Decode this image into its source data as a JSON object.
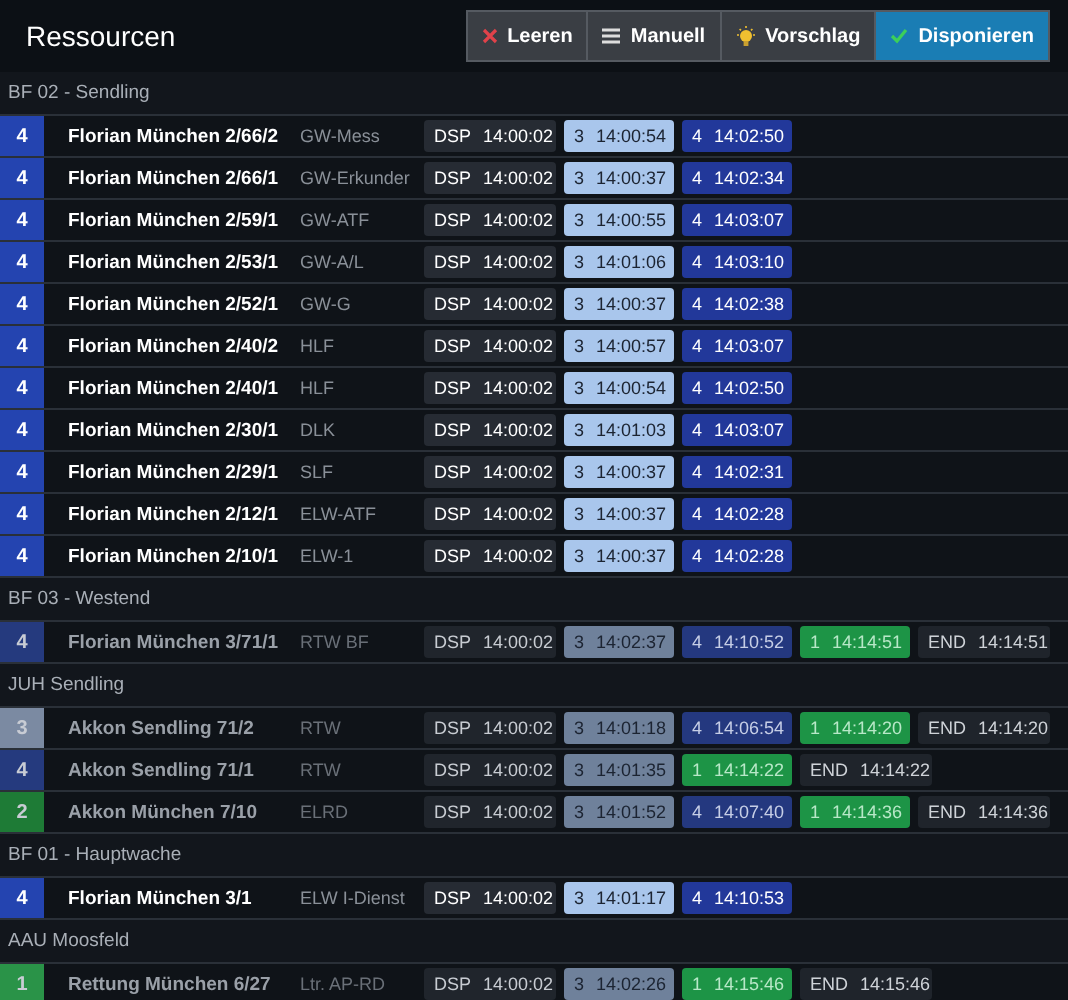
{
  "title": "Ressourcen",
  "buttons": [
    {
      "label": "Leeren",
      "kind": "clear"
    },
    {
      "label": "Manuell",
      "kind": "manual"
    },
    {
      "label": "Vorschlag",
      "kind": "suggest"
    },
    {
      "label": "Disponieren",
      "kind": "dispatch"
    }
  ],
  "groups": [
    {
      "name": "BF 02 - Sendling",
      "rows": [
        {
          "status": "4",
          "color": "#2444b0",
          "active": true,
          "name": "Florian München 2/66/2",
          "type": "GW-Mess",
          "chips": [
            {
              "kind": "dsp",
              "code": "DSP",
              "time": "14:00:02"
            },
            {
              "kind": "s3",
              "code": "3",
              "time": "14:00:54"
            },
            {
              "kind": "s4",
              "code": "4",
              "time": "14:02:50"
            }
          ]
        },
        {
          "status": "4",
          "color": "#2444b0",
          "active": true,
          "name": "Florian München 2/66/1",
          "type": "GW-Erkunder",
          "chips": [
            {
              "kind": "dsp",
              "code": "DSP",
              "time": "14:00:02"
            },
            {
              "kind": "s3",
              "code": "3",
              "time": "14:00:37"
            },
            {
              "kind": "s4",
              "code": "4",
              "time": "14:02:34"
            }
          ]
        },
        {
          "status": "4",
          "color": "#2444b0",
          "active": true,
          "name": "Florian München 2/59/1",
          "type": "GW-ATF",
          "chips": [
            {
              "kind": "dsp",
              "code": "DSP",
              "time": "14:00:02"
            },
            {
              "kind": "s3",
              "code": "3",
              "time": "14:00:55"
            },
            {
              "kind": "s4",
              "code": "4",
              "time": "14:03:07"
            }
          ]
        },
        {
          "status": "4",
          "color": "#2444b0",
          "active": true,
          "name": "Florian München 2/53/1",
          "type": "GW-A/L",
          "chips": [
            {
              "kind": "dsp",
              "code": "DSP",
              "time": "14:00:02"
            },
            {
              "kind": "s3",
              "code": "3",
              "time": "14:01:06"
            },
            {
              "kind": "s4",
              "code": "4",
              "time": "14:03:10"
            }
          ]
        },
        {
          "status": "4",
          "color": "#2444b0",
          "active": true,
          "name": "Florian München 2/52/1",
          "type": "GW-G",
          "chips": [
            {
              "kind": "dsp",
              "code": "DSP",
              "time": "14:00:02"
            },
            {
              "kind": "s3",
              "code": "3",
              "time": "14:00:37"
            },
            {
              "kind": "s4",
              "code": "4",
              "time": "14:02:38"
            }
          ]
        },
        {
          "status": "4",
          "color": "#2444b0",
          "active": true,
          "name": "Florian München 2/40/2",
          "type": "HLF",
          "chips": [
            {
              "kind": "dsp",
              "code": "DSP",
              "time": "14:00:02"
            },
            {
              "kind": "s3",
              "code": "3",
              "time": "14:00:57"
            },
            {
              "kind": "s4",
              "code": "4",
              "time": "14:03:07"
            }
          ]
        },
        {
          "status": "4",
          "color": "#2444b0",
          "active": true,
          "name": "Florian München 2/40/1",
          "type": "HLF",
          "chips": [
            {
              "kind": "dsp",
              "code": "DSP",
              "time": "14:00:02"
            },
            {
              "kind": "s3",
              "code": "3",
              "time": "14:00:54"
            },
            {
              "kind": "s4",
              "code": "4",
              "time": "14:02:50"
            }
          ]
        },
        {
          "status": "4",
          "color": "#2444b0",
          "active": true,
          "name": "Florian München 2/30/1",
          "type": "DLK",
          "chips": [
            {
              "kind": "dsp",
              "code": "DSP",
              "time": "14:00:02"
            },
            {
              "kind": "s3",
              "code": "3",
              "time": "14:01:03"
            },
            {
              "kind": "s4",
              "code": "4",
              "time": "14:03:07"
            }
          ]
        },
        {
          "status": "4",
          "color": "#2444b0",
          "active": true,
          "name": "Florian München 2/29/1",
          "type": "SLF",
          "chips": [
            {
              "kind": "dsp",
              "code": "DSP",
              "time": "14:00:02"
            },
            {
              "kind": "s3",
              "code": "3",
              "time": "14:00:37"
            },
            {
              "kind": "s4",
              "code": "4",
              "time": "14:02:31"
            }
          ]
        },
        {
          "status": "4",
          "color": "#2444b0",
          "active": true,
          "name": "Florian München 2/12/1",
          "type": "ELW-ATF",
          "chips": [
            {
              "kind": "dsp",
              "code": "DSP",
              "time": "14:00:02"
            },
            {
              "kind": "s3",
              "code": "3",
              "time": "14:00:37"
            },
            {
              "kind": "s4",
              "code": "4",
              "time": "14:02:28"
            }
          ]
        },
        {
          "status": "4",
          "color": "#2444b0",
          "active": true,
          "name": "Florian München 2/10/1",
          "type": "ELW-1",
          "chips": [
            {
              "kind": "dsp",
              "code": "DSP",
              "time": "14:00:02"
            },
            {
              "kind": "s3",
              "code": "3",
              "time": "14:00:37"
            },
            {
              "kind": "s4",
              "code": "4",
              "time": "14:02:28"
            }
          ]
        }
      ]
    },
    {
      "name": "BF 03 - Westend",
      "rows": [
        {
          "status": "4",
          "color": "#253a7e",
          "active": false,
          "name": "Florian München 3/71/1",
          "type": "RTW BF",
          "chips": [
            {
              "kind": "dsp",
              "code": "DSP",
              "time": "14:00:02"
            },
            {
              "kind": "s3",
              "code": "3",
              "time": "14:02:37"
            },
            {
              "kind": "s4",
              "code": "4",
              "time": "14:10:52"
            },
            {
              "kind": "s1",
              "code": "1",
              "time": "14:14:51"
            },
            {
              "kind": "end",
              "code": "END",
              "time": "14:14:51"
            }
          ]
        }
      ]
    },
    {
      "name": "JUH Sendling",
      "rows": [
        {
          "status": "3",
          "color": "#7b8aa2",
          "active": false,
          "name": "Akkon Sendling 71/2",
          "type": "RTW",
          "chips": [
            {
              "kind": "dsp",
              "code": "DSP",
              "time": "14:00:02"
            },
            {
              "kind": "s3",
              "code": "3",
              "time": "14:01:18"
            },
            {
              "kind": "s4",
              "code": "4",
              "time": "14:06:54"
            },
            {
              "kind": "s1",
              "code": "1",
              "time": "14:14:20"
            },
            {
              "kind": "end",
              "code": "END",
              "time": "14:14:20"
            }
          ]
        },
        {
          "status": "4",
          "color": "#253a7e",
          "active": false,
          "name": "Akkon Sendling 71/1",
          "type": "RTW",
          "chips": [
            {
              "kind": "dsp",
              "code": "DSP",
              "time": "14:00:02"
            },
            {
              "kind": "s3",
              "code": "3",
              "time": "14:01:35"
            },
            {
              "kind": "s1",
              "code": "1",
              "time": "14:14:22"
            },
            {
              "kind": "end",
              "code": "END",
              "time": "14:14:22"
            }
          ]
        },
        {
          "status": "2",
          "color": "#1e7b36",
          "active": false,
          "name": "Akkon München 7/10",
          "type": "ELRD",
          "chips": [
            {
              "kind": "dsp",
              "code": "DSP",
              "time": "14:00:02"
            },
            {
              "kind": "s3",
              "code": "3",
              "time": "14:01:52"
            },
            {
              "kind": "s4",
              "code": "4",
              "time": "14:07:40"
            },
            {
              "kind": "s1",
              "code": "1",
              "time": "14:14:36"
            },
            {
              "kind": "end",
              "code": "END",
              "time": "14:14:36"
            }
          ]
        }
      ]
    },
    {
      "name": "BF 01 - Hauptwache",
      "rows": [
        {
          "status": "4",
          "color": "#2444b0",
          "active": true,
          "name": "Florian München 3/1",
          "type": "ELW I-Dienst",
          "chips": [
            {
              "kind": "dsp",
              "code": "DSP",
              "time": "14:00:02"
            },
            {
              "kind": "s3",
              "code": "3",
              "time": "14:01:17"
            },
            {
              "kind": "s4",
              "code": "4",
              "time": "14:10:53"
            }
          ]
        }
      ]
    },
    {
      "name": "AAU Moosfeld",
      "rows": [
        {
          "status": "1",
          "color": "#2a9348",
          "active": false,
          "name": "Rettung München 6/27",
          "type": "Ltr. AP-RD",
          "chips": [
            {
              "kind": "dsp",
              "code": "DSP",
              "time": "14:00:02"
            },
            {
              "kind": "s3",
              "code": "3",
              "time": "14:02:26"
            },
            {
              "kind": "s1",
              "code": "1",
              "time": "14:15:46"
            },
            {
              "kind": "end",
              "code": "END",
              "time": "14:15:46"
            }
          ]
        }
      ]
    }
  ]
}
